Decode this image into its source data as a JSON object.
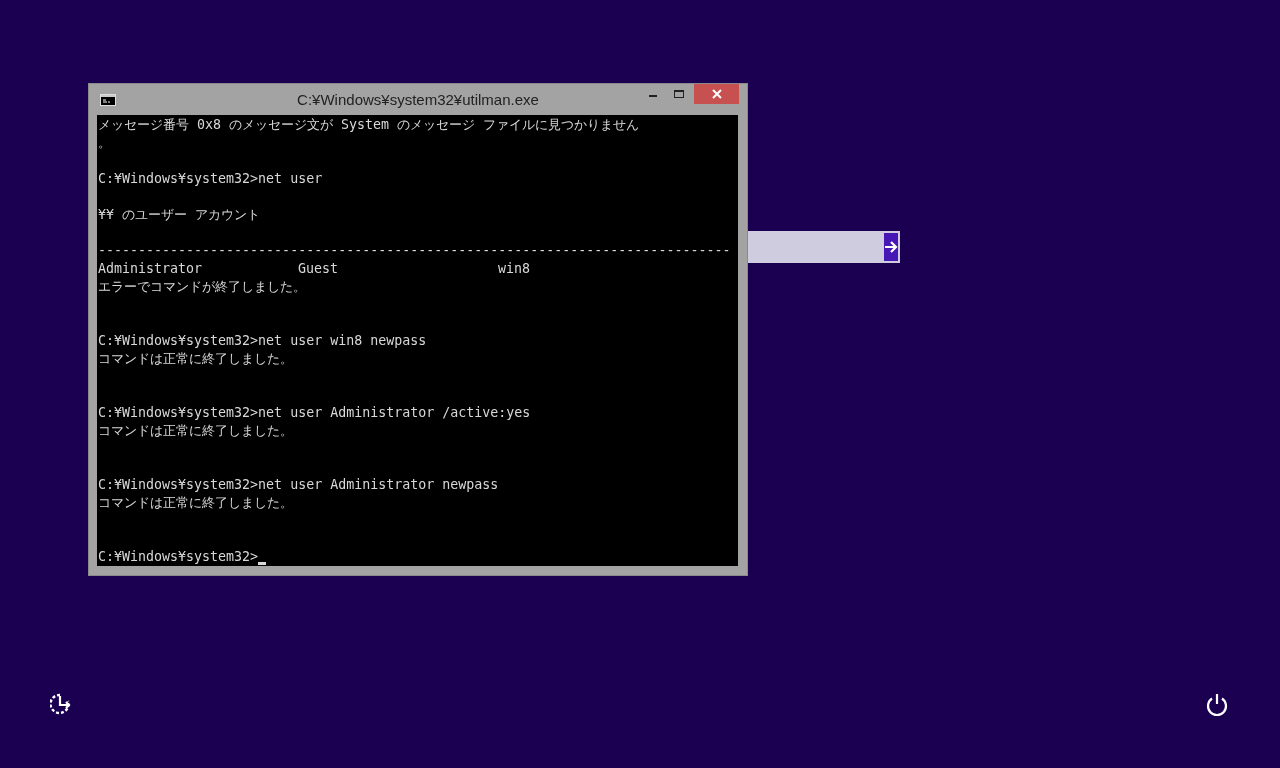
{
  "console_window": {
    "title": "C:¥Windows¥system32¥utilman.exe",
    "lines": [
      {
        "kind": "text",
        "text": "メッセージ番号 0x8 のメッセージ文が System のメッセージ ファイルに見つかりません"
      },
      {
        "kind": "text",
        "text": "。"
      },
      {
        "kind": "blank"
      },
      {
        "kind": "text",
        "text": "C:¥Windows¥system32>net user"
      },
      {
        "kind": "blank"
      },
      {
        "kind": "text",
        "text": "¥¥ のユーザー アカウント"
      },
      {
        "kind": "blank"
      },
      {
        "kind": "text",
        "text": "-------------------------------------------------------------------------------"
      },
      {
        "kind": "columns",
        "cells": [
          "Administrator",
          "Guest",
          "win8"
        ]
      },
      {
        "kind": "text",
        "text": "エラーでコマンドが終了しました。"
      },
      {
        "kind": "blank"
      },
      {
        "kind": "blank"
      },
      {
        "kind": "text",
        "text": "C:¥Windows¥system32>net user win8 newpass"
      },
      {
        "kind": "text",
        "text": "コマンドは正常に終了しました。"
      },
      {
        "kind": "blank"
      },
      {
        "kind": "blank"
      },
      {
        "kind": "text",
        "text": "C:¥Windows¥system32>net user Administrator /active:yes"
      },
      {
        "kind": "text",
        "text": "コマンドは正常に終了しました。"
      },
      {
        "kind": "blank"
      },
      {
        "kind": "blank"
      },
      {
        "kind": "text",
        "text": "C:¥Windows¥system32>net user Administrator newpass"
      },
      {
        "kind": "text",
        "text": "コマンドは正常に終了しました。"
      },
      {
        "kind": "blank"
      },
      {
        "kind": "blank"
      },
      {
        "kind": "prompt",
        "text": "C:¥Windows¥system32>"
      }
    ]
  }
}
